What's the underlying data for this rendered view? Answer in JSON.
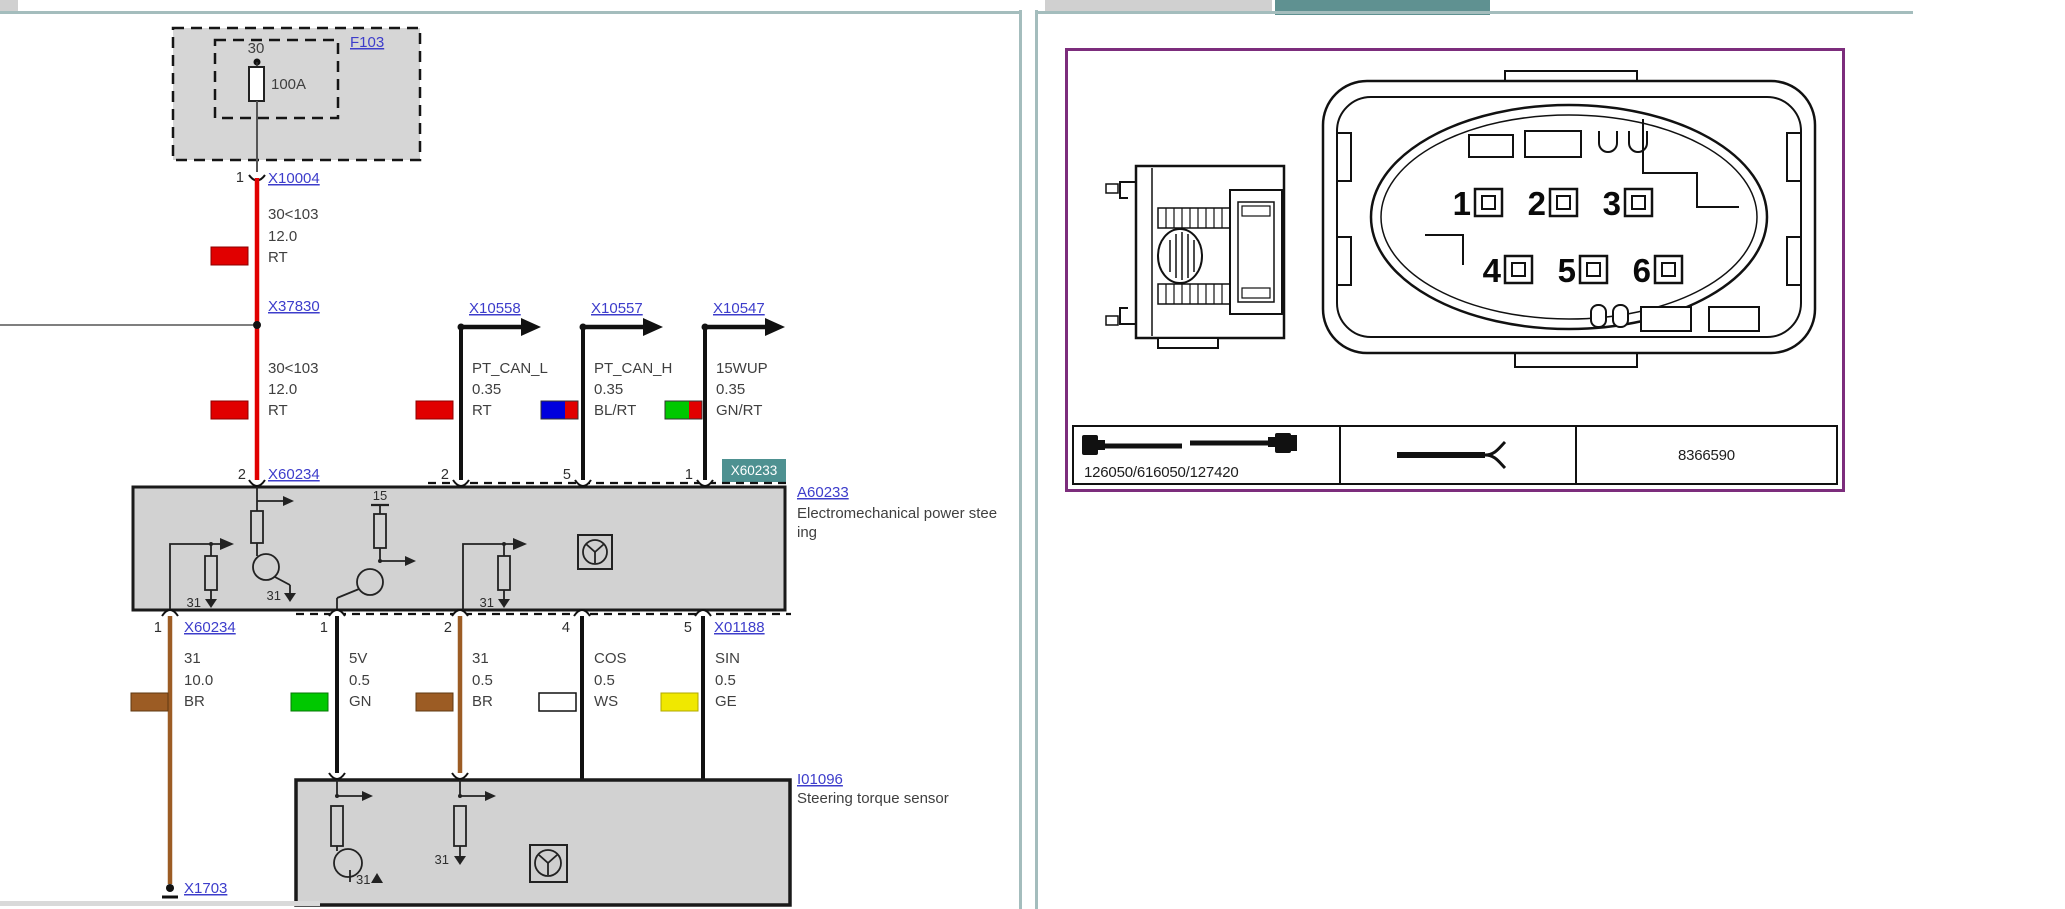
{
  "colors": {
    "accent_teal": "#5f9191",
    "teal_line": "#a4bdbd",
    "purple_border": "#7c2d7c",
    "link_blue": "#3d3dcb",
    "highlight_badge_bg": "#4e9191",
    "diagram_gray": "#d2d2d2",
    "wire_red": "#e10000",
    "wire_brown": "#9c5c24",
    "wire_black": "#111111",
    "swatch_green": "#00c800",
    "swatch_yellow": "#f0e800",
    "swatch_blue": "#0000dd",
    "swatch_white": "#ffffff"
  },
  "schematic": {
    "fuse_box": {
      "id": "F103",
      "terminal": "30",
      "rating": "100A"
    },
    "x10004": {
      "pin": "1",
      "label": "X10004"
    },
    "wire_30_upper": {
      "circuit": "30<103",
      "size": "12.0",
      "color": "RT"
    },
    "x37830": {
      "label": "X37830"
    },
    "wire_30_lower": {
      "circuit": "30<103",
      "size": "12.0",
      "color": "RT"
    },
    "branches": [
      {
        "label": "X10558",
        "circuit": "PT_CAN_L",
        "size": "0.35",
        "color": "RT",
        "pin": "2"
      },
      {
        "label": "X10557",
        "circuit": "PT_CAN_H",
        "size": "0.35",
        "color": "BL/RT",
        "pin": "5"
      },
      {
        "label": "X10547",
        "circuit": "15WUP",
        "size": "0.35",
        "color": "GN/RT",
        "pin": "1"
      }
    ],
    "ecu": {
      "top_pin": "2",
      "top_connector": "X60234",
      "badge": "X60233",
      "id": "A60233",
      "desc_line1": "Electromechanical power stee",
      "desc_line2": "ing",
      "terminal_15": "15",
      "terminal_31": "31"
    },
    "bottom_wires": [
      {
        "pin": "1",
        "connector": "X60234",
        "circuit": "31",
        "size": "10.0",
        "color": "BR"
      },
      {
        "pin": "1",
        "circuit": "5V",
        "size": "0.5",
        "color": "GN"
      },
      {
        "pin": "2",
        "circuit": "31",
        "size": "0.5",
        "color": "BR"
      },
      {
        "pin": "4",
        "circuit": "COS",
        "size": "0.5",
        "color": "WS"
      },
      {
        "pin": "5",
        "connector": "X01188",
        "circuit": "SIN",
        "size": "0.5",
        "color": "GE"
      }
    ],
    "sensor": {
      "id": "I01096",
      "desc": "Steering torque sensor",
      "terminal_31": "31"
    },
    "x1703": {
      "label": "X1703"
    }
  },
  "connector_view": {
    "pins": [
      "1",
      "2",
      "3",
      "4",
      "5",
      "6"
    ],
    "cable_part_numbers": "126050/616050/127420",
    "part_number": "8366590"
  }
}
